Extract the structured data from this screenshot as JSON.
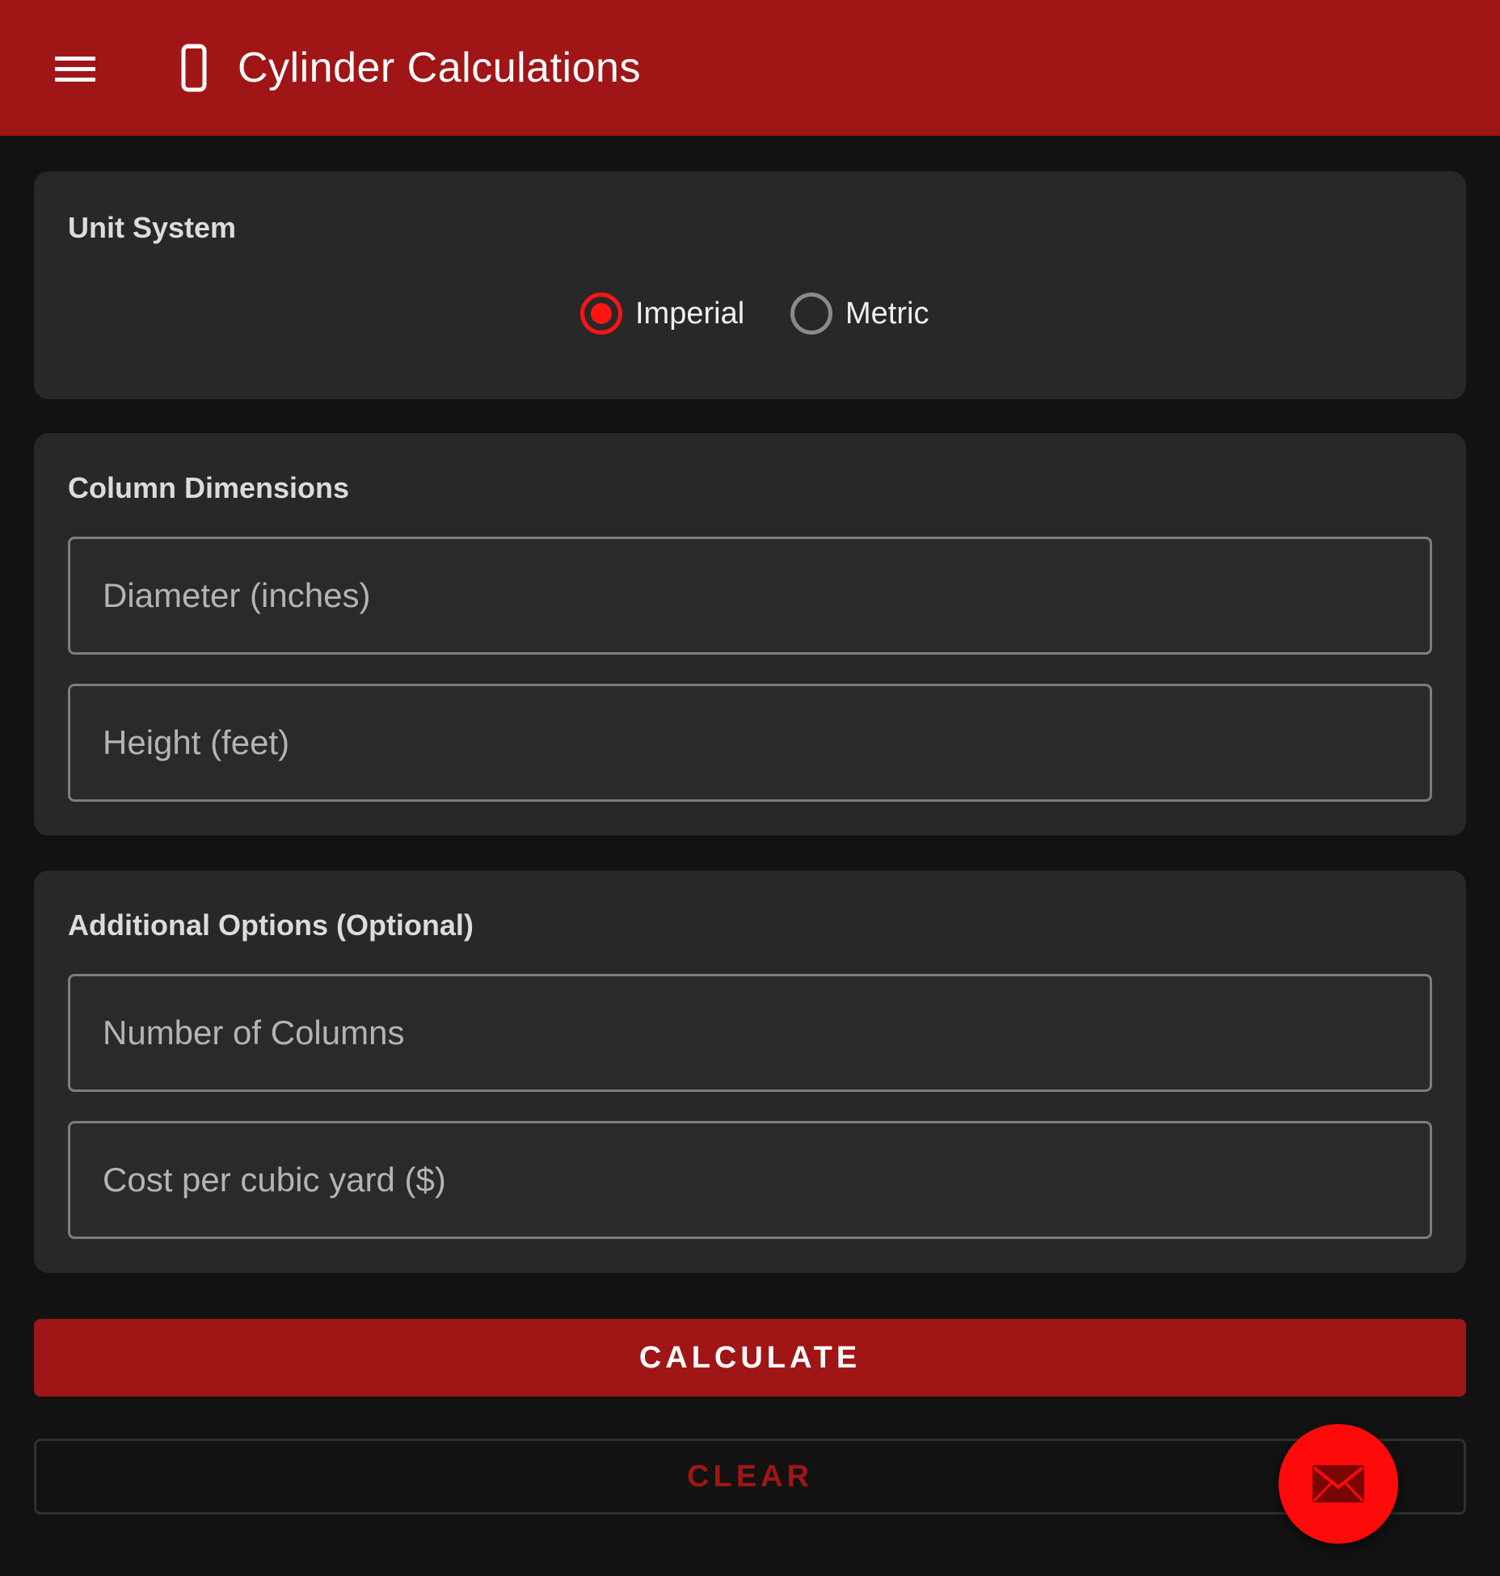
{
  "app_bar": {
    "title": "Cylinder Calculations",
    "menu_icon": "hamburger-menu-icon",
    "title_icon": "cylinder-icon",
    "background_color": "#a01516"
  },
  "unit_system": {
    "title": "Unit System",
    "options": [
      {
        "label": "Imperial",
        "selected": true
      },
      {
        "label": "Metric",
        "selected": false
      }
    ]
  },
  "column_dimensions": {
    "title": "Column Dimensions",
    "diameter_placeholder": "Diameter (inches)",
    "diameter_value": "",
    "height_placeholder": "Height (feet)",
    "height_value": ""
  },
  "additional_options": {
    "title": "Additional Options (Optional)",
    "columns_placeholder": "Number of Columns",
    "columns_value": "",
    "cost_placeholder": "Cost per cubic yard ($)",
    "cost_value": ""
  },
  "actions": {
    "calculate_label": "CALCULATE",
    "clear_label": "CLEAR"
  },
  "fab": {
    "icon": "email-icon",
    "color": "#ff0a0a"
  },
  "colors": {
    "accent": "#ff1414",
    "brand": "#a01516",
    "background": "#121212",
    "card": "#282828"
  }
}
